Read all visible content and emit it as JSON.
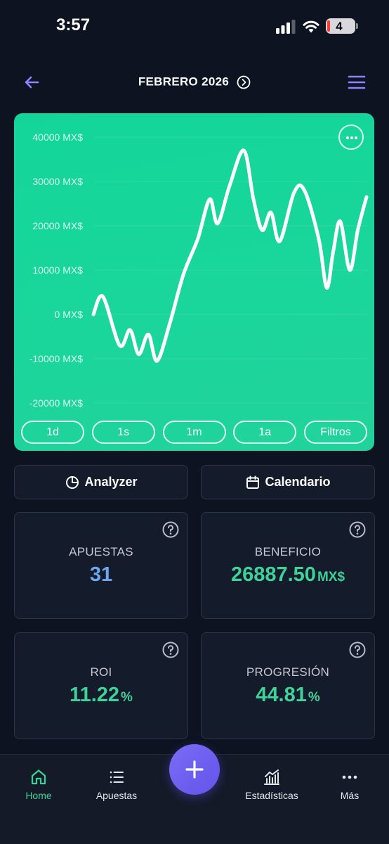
{
  "status_bar": {
    "time": "3:57",
    "battery": "4"
  },
  "header": {
    "title": "FEBRERO 2026"
  },
  "chart": {
    "range_buttons": [
      "1d",
      "1s",
      "1m",
      "1a",
      "Filtros"
    ]
  },
  "chart_data": {
    "type": "line",
    "y_tick_labels": [
      "40000 MX$",
      "30000 MX$",
      "20000 MX$",
      "10000 MX$",
      "0 MX$",
      "-10000 MX$",
      "-20000 MX$"
    ],
    "y_ticks": [
      40000,
      30000,
      20000,
      10000,
      0,
      -10000,
      -20000
    ],
    "ylim": [
      -20000,
      40000
    ],
    "grid": true,
    "x": [
      0,
      1,
      2,
      3,
      4,
      5,
      6,
      7,
      8,
      9,
      10,
      11,
      12,
      13,
      14,
      15,
      16,
      17,
      18,
      19,
      20,
      21,
      22,
      23,
      24,
      25,
      26,
      27,
      28,
      29,
      30,
      31
    ],
    "series": [
      {
        "values": [
          0,
          4000,
          -7000,
          -3500,
          -9000,
          -4500,
          -10500,
          -2000,
          9000,
          17000,
          26000,
          20500,
          29000,
          37000,
          26000,
          19000,
          23000,
          16500,
          27500,
          28000,
          17000,
          6000,
          14000,
          21000,
          10000,
          19000,
          26500
        ],
        "x": [
          0,
          1.2,
          3.3,
          4.6,
          5.7,
          6.9,
          8.0,
          9.6,
          11.3,
          13.1,
          14.6,
          15.6,
          17.1,
          18.9,
          20.1,
          21.2,
          22.3,
          23.4,
          25.2,
          26.5,
          28.3,
          29.3,
          30.1,
          31.0,
          32.2,
          33.2,
          34.3
        ]
      }
    ]
  },
  "actions": {
    "analyzer": "Analyzer",
    "calendar": "Calendario"
  },
  "stats": {
    "bets": {
      "label": "APUESTAS",
      "value": "31"
    },
    "profit": {
      "label": "BENEFICIO",
      "value": "26887.50",
      "unit": "MX$"
    },
    "roi": {
      "label": "ROI",
      "value": "11.22",
      "unit": "%"
    },
    "progression": {
      "label": "PROGRESIÓN",
      "value": "44.81",
      "unit": "%"
    }
  },
  "colors": {
    "accent_green": "#3ed198",
    "accent_blue": "#6da7f0",
    "chart_bg": "#1ad69a",
    "fab": "#6c5cf0",
    "background": "#0d1321"
  },
  "nav": {
    "home": "Home",
    "bets": "Apuestas",
    "stats": "Estadísticas",
    "more": "Más"
  }
}
